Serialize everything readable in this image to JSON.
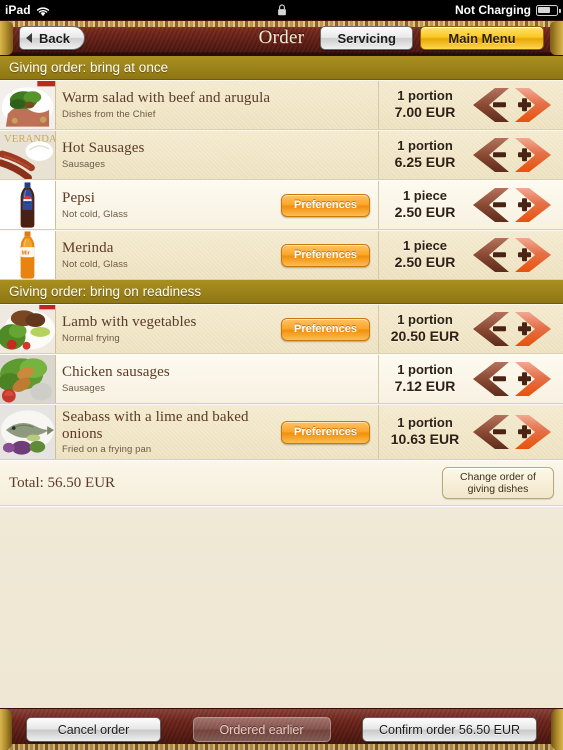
{
  "status_bar": {
    "device": "iPad",
    "wifi_icon": "wifi-icon",
    "lock_icon": "rotation-lock-icon",
    "battery_label": "Not Charging",
    "battery_icon": "battery-icon"
  },
  "navbar": {
    "back_label": "Back",
    "back_icon": "chevron-left-icon",
    "title": "Order",
    "servicing_label": "Servicing",
    "main_menu_label": "Main Menu"
  },
  "sections": [
    {
      "header": "Giving order: bring at once",
      "items": [
        {
          "thumb": "salad-photo-thumbnail",
          "title": "Warm salad with beef and arugula",
          "subtitle": "Dishes from the Chief",
          "preferences": null,
          "qty": "1 portion",
          "price": "7.00 EUR",
          "minus_icon": "minus-chevron-icon",
          "plus_icon": "plus-chevron-icon"
        },
        {
          "thumb": "sausages-photo-thumbnail",
          "title": "Hot Sausages",
          "subtitle": "Sausages",
          "preferences": null,
          "qty": "1 portion",
          "price": "6.25 EUR",
          "minus_icon": "minus-chevron-icon",
          "plus_icon": "plus-chevron-icon"
        },
        {
          "thumb": "pepsi-bottle-thumbnail",
          "title": "Pepsi",
          "subtitle": "Not cold, Glass",
          "preferences": "Preferences",
          "qty": "1 piece",
          "price": "2.50 EUR",
          "minus_icon": "minus-chevron-icon",
          "plus_icon": "plus-chevron-icon"
        },
        {
          "thumb": "merinda-bottle-thumbnail",
          "title": "Merinda",
          "subtitle": "Not cold, Glass",
          "preferences": "Preferences",
          "qty": "1 piece",
          "price": "2.50 EUR",
          "minus_icon": "minus-chevron-icon",
          "plus_icon": "plus-chevron-icon"
        }
      ]
    },
    {
      "header": "Giving order: bring on readiness",
      "items": [
        {
          "thumb": "lamb-photo-thumbnail",
          "title": "Lamb with vegetables",
          "subtitle": "Normal frying",
          "preferences": "Preferences",
          "qty": "1 portion",
          "price": "20.50 EUR",
          "minus_icon": "minus-chevron-icon",
          "plus_icon": "plus-chevron-icon"
        },
        {
          "thumb": "chicken-sausages-photo-thumbnail",
          "title": "Chicken sausages",
          "subtitle": "Sausages",
          "preferences": null,
          "qty": "1 portion",
          "price": "7.12 EUR",
          "minus_icon": "minus-chevron-icon",
          "plus_icon": "plus-chevron-icon"
        },
        {
          "thumb": "seabass-photo-thumbnail",
          "title": "Seabass with a lime and baked onions",
          "subtitle": "Fried on a frying pan",
          "preferences": "Preferences",
          "qty": "1 portion",
          "price": "10.63 EUR",
          "minus_icon": "minus-chevron-icon",
          "plus_icon": "plus-chevron-icon"
        }
      ]
    }
  ],
  "total_bar": {
    "total_label": "Total: 56.50 EUR",
    "change_order_label": "Change order of giving dishes"
  },
  "toolbar": {
    "cancel_label": "Cancel order",
    "ordered_earlier_label": "Ordered earlier",
    "confirm_label": "Confirm order 56.50 EUR"
  },
  "colors": {
    "navbar_leather": "#6c2218",
    "section_header": "#9a8119",
    "gold_accent": "#d9b64f",
    "preferences_button": "#fba427",
    "main_menu_button": "#f9c81f",
    "row_beige": "#efe3c2",
    "row_cream": "#faf5e8",
    "title_text": "#5c3a27"
  }
}
